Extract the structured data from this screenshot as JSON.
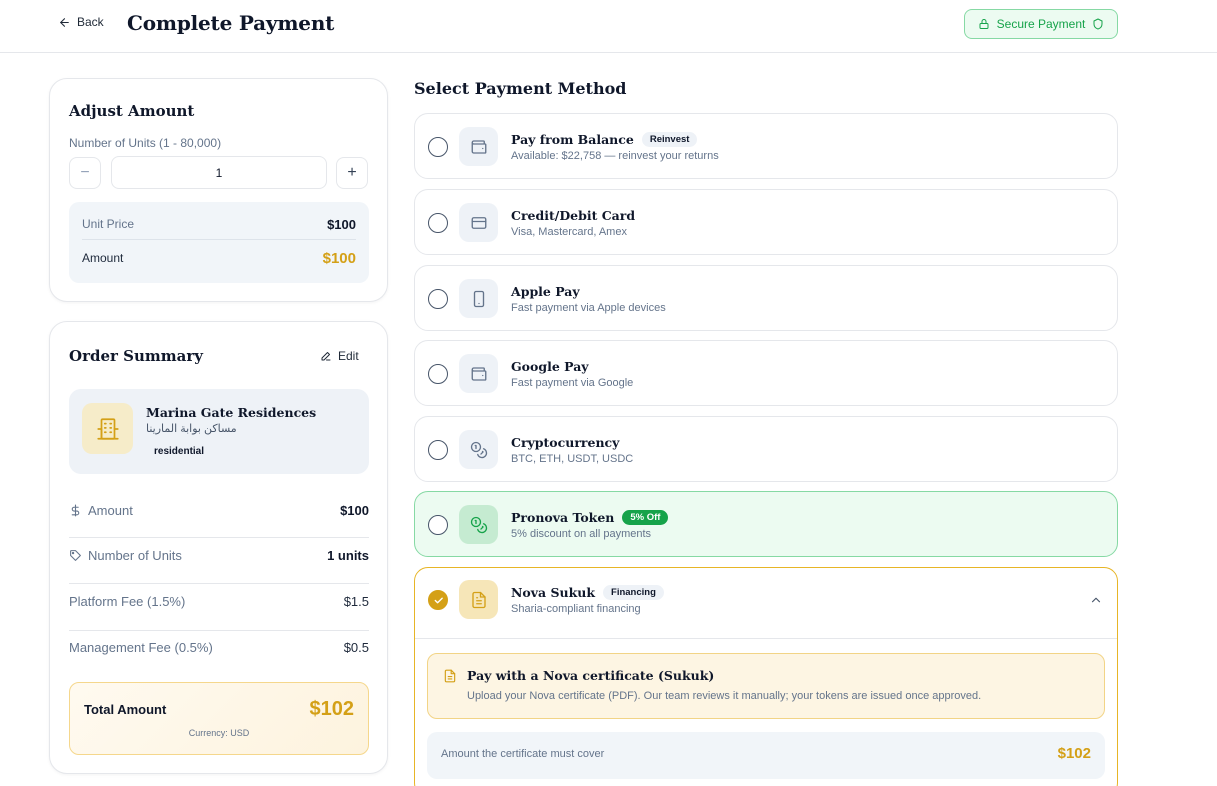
{
  "header": {
    "back_label": "Back",
    "title": "Complete Payment",
    "secure_label": "Secure Payment"
  },
  "adjust": {
    "title": "Adjust Amount",
    "units_label": "Number of Units (1 - 80,000)",
    "units_value": "1",
    "minus": "−",
    "plus": "+",
    "unit_price_label": "Unit Price",
    "unit_price_value": "$100",
    "amount_label": "Amount",
    "amount_value": "$100"
  },
  "summary": {
    "title": "Order Summary",
    "edit_label": "Edit",
    "property": {
      "name": "Marina Gate Residences",
      "name_ar": "مساكن بوابة المارينا",
      "tag": "residential"
    },
    "rows": [
      {
        "label": "Amount",
        "value": "$100",
        "icon": "dollar-icon"
      },
      {
        "label": "Number of Units",
        "value": "1 units",
        "icon": "tag-icon"
      },
      {
        "label": "Platform Fee (1.5%)",
        "value": "$1.5"
      },
      {
        "label": "Management Fee (0.5%)",
        "value": "$0.5"
      }
    ],
    "total_label": "Total Amount",
    "total_value": "$102",
    "currency": "Currency: USD"
  },
  "payment": {
    "section_title": "Select Payment Method",
    "methods": [
      {
        "title": "Pay from Balance",
        "badge": "Reinvest",
        "subtitle": "Available: $22,758 — reinvest your returns",
        "icon": "wallet-icon"
      },
      {
        "title": "Credit/Debit Card",
        "subtitle": "Visa, Mastercard, Amex",
        "icon": "credit-card-icon"
      },
      {
        "title": "Apple Pay",
        "subtitle": "Fast payment via Apple devices",
        "icon": "smartphone-icon"
      },
      {
        "title": "Google Pay",
        "subtitle": "Fast payment via Google",
        "icon": "wallet-icon"
      },
      {
        "title": "Cryptocurrency",
        "subtitle": "BTC, ETH, USDT, USDC",
        "icon": "coins-icon"
      },
      {
        "title": "Pronova Token",
        "badge": "5% Off",
        "subtitle": "5% discount on all payments",
        "icon": "coins-icon"
      },
      {
        "title": "Nova Sukuk",
        "badge": "Financing",
        "subtitle": "Sharia-compliant financing",
        "icon": "document-icon",
        "selected": true
      }
    ],
    "sukuk": {
      "cert_title": "Pay with a Nova certificate (Sukuk)",
      "cert_desc": "Upload your Nova certificate (PDF). Our team reviews it manually; your tokens are issued once approved.",
      "cover_label": "Amount the certificate must cover",
      "cover_value": "$102"
    }
  },
  "colors": {
    "accent_gold": "#d4a017",
    "success_green": "#16a34a"
  }
}
